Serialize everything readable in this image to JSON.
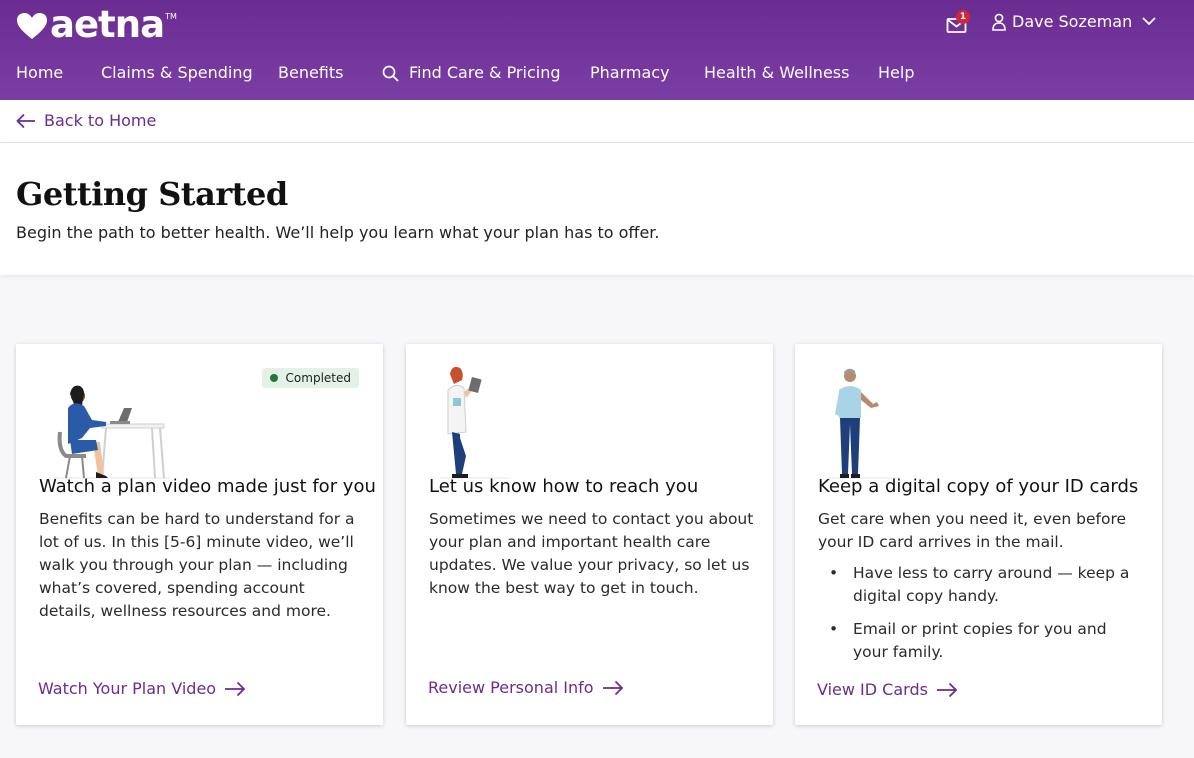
{
  "brand": {
    "name": "aetna",
    "tm": "TM",
    "accent": "#6a2c91"
  },
  "header": {
    "mail_badge": "1",
    "user_name": "Dave Sozeman",
    "nav": [
      {
        "label": "Home"
      },
      {
        "label": "Claims & Spending"
      },
      {
        "label": "Benefits"
      },
      {
        "label": "Find Care & Pricing",
        "icon": "search-icon"
      },
      {
        "label": "Pharmacy"
      },
      {
        "label": "Health & Wellness"
      },
      {
        "label": "Help"
      }
    ]
  },
  "back": {
    "label": "Back to Home"
  },
  "page": {
    "title": "Getting Started",
    "subtitle": "Begin the path to better health. We’ll help you learn what your plan has to offer."
  },
  "cards": [
    {
      "badge": "Completed",
      "title": "Watch a plan video made just for you",
      "body": "Benefits can be hard to understand for a lot of us. In this [5-6] minute video, we’ll walk you through your plan — including what’s covered, spending account details, wellness resources and more.",
      "link": "Watch Your Plan Video"
    },
    {
      "title": "Let us know how to reach you",
      "body": "Sometimes we need to contact you about your plan and important health care updates. We value your privacy, so let us know the best way to get in touch.",
      "link": "Review Personal Info"
    },
    {
      "title": "Keep a digital copy of your ID cards",
      "body": "Get care when you need it, even before your ID card arrives in the mail.",
      "bullets": [
        "Have less to carry around — keep a digital copy handy.",
        "Email or print copies for you and your family."
      ],
      "link": "View ID Cards"
    }
  ]
}
